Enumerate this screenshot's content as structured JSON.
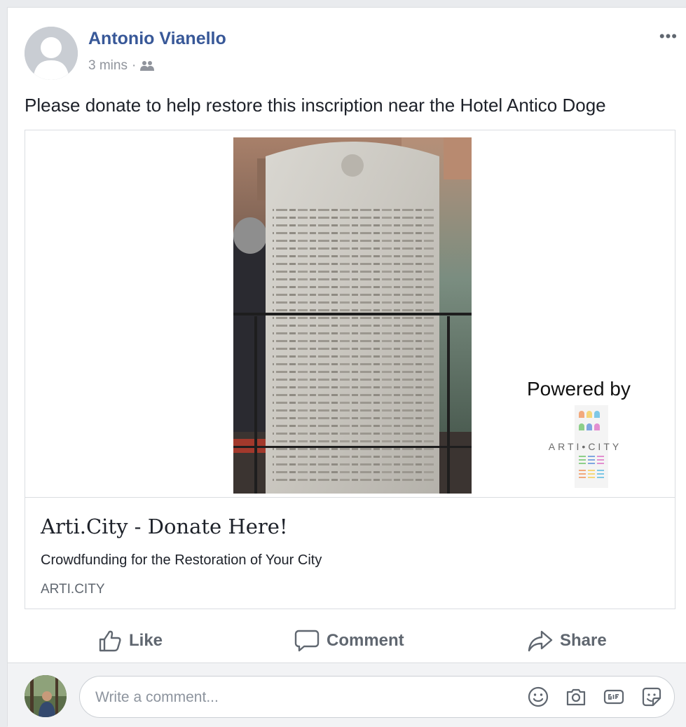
{
  "post": {
    "author": "Antonio Vianello",
    "time": "3 mins",
    "separator": "·",
    "audience_icon": "friends-icon",
    "more_label": "•••",
    "text": "Please donate to help restore this inscription near the Hotel Antico Doge"
  },
  "link": {
    "image_caption": "Powered by",
    "logo_text": "ARTI•CITY",
    "title": "Arti.City - Donate Here!",
    "description": "Crowdfunding for the Restoration of Your City",
    "domain": "ARTI.CITY"
  },
  "actions": {
    "like": "Like",
    "comment": "Comment",
    "share": "Share"
  },
  "comment_bar": {
    "placeholder": "Write a comment...",
    "icons": [
      "emoji-icon",
      "camera-icon",
      "gif-icon",
      "sticker-icon"
    ]
  },
  "colors": {
    "author_blue": "#385898",
    "muted": "#606770",
    "border": "#dadde1"
  }
}
